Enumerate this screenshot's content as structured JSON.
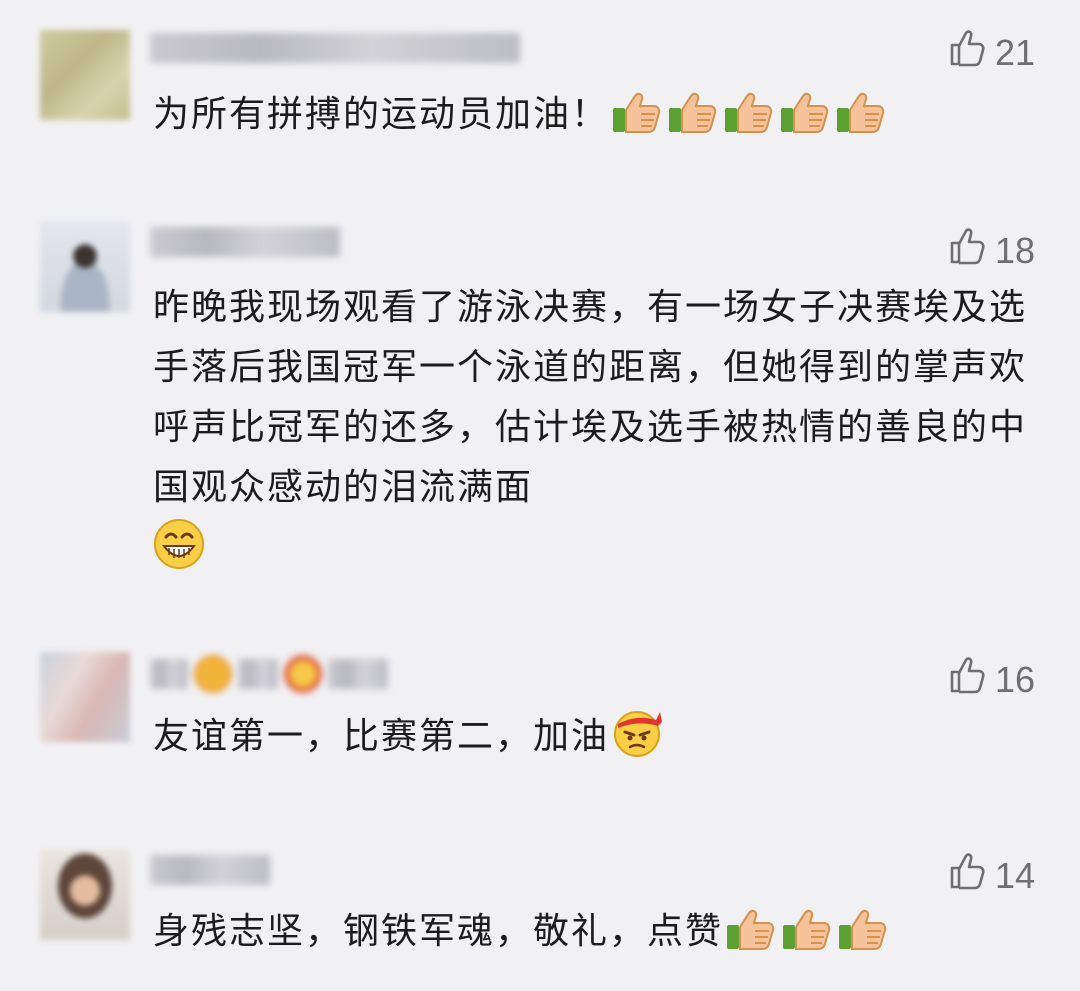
{
  "comments": [
    {
      "likes": "21",
      "text": "为所有拼搏的运动员加油！",
      "trailing_emojis": [
        "thumbs-up",
        "thumbs-up",
        "thumbs-up",
        "thumbs-up",
        "thumbs-up"
      ]
    },
    {
      "likes": "18",
      "text": "昨晚我现场观看了游泳决赛，有一场女子决赛埃及选手落后我国冠军一个泳道的距离，但她得到的掌声欢呼声比冠军的还多，估计埃及选手被热情的善良的中国观众感动的泪流满面",
      "trailing_emojis": [
        "grin"
      ]
    },
    {
      "likes": "16",
      "text": "友谊第一，比赛第二，加油",
      "trailing_emojis": [
        "determined-face"
      ]
    },
    {
      "likes": "14",
      "text": "身残志坚，钢铁军魂，敬礼，点赞",
      "trailing_emojis": [
        "thumbs-up",
        "thumbs-up",
        "thumbs-up"
      ]
    }
  ],
  "icons": {
    "like": "thumb-up-outline-icon"
  },
  "colors": {
    "background": "#f1f1f3",
    "text": "#1c1c1c",
    "like_count": "#6e6e73"
  }
}
